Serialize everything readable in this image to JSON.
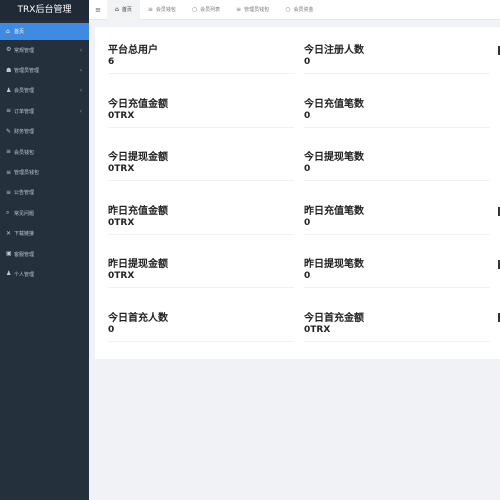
{
  "app": {
    "title": "TRX后台管理"
  },
  "sidebar": {
    "items": [
      {
        "label": "首页",
        "icon": "home-icon",
        "glyph": "⌂",
        "active": true,
        "has_arrow": false
      },
      {
        "label": "常规管理",
        "icon": "gears-icon",
        "glyph": "⚙",
        "active": false,
        "has_arrow": true
      },
      {
        "label": "管理员管理",
        "icon": "users-icon",
        "glyph": "☗",
        "active": false,
        "has_arrow": true
      },
      {
        "label": "会员管理",
        "icon": "user-icon",
        "glyph": "♟",
        "active": false,
        "has_arrow": true
      },
      {
        "label": "订单管理",
        "icon": "list-icon",
        "glyph": "≡",
        "active": false,
        "has_arrow": true
      },
      {
        "label": "财务管理",
        "icon": "edit-icon",
        "glyph": "✎",
        "active": false,
        "has_arrow": false
      },
      {
        "label": "会员钱包",
        "icon": "list-icon",
        "glyph": "≡",
        "active": false,
        "has_arrow": false
      },
      {
        "label": "管理员钱包",
        "icon": "list-icon",
        "glyph": "≡",
        "active": false,
        "has_arrow": false
      },
      {
        "label": "公告管理",
        "icon": "list-icon",
        "glyph": "≡",
        "active": false,
        "has_arrow": false
      },
      {
        "label": "常见问题",
        "icon": "search-icon",
        "glyph": "⌕",
        "active": false,
        "has_arrow": false
      },
      {
        "label": "下载链接",
        "icon": "close-icon",
        "glyph": "✕",
        "active": false,
        "has_arrow": false
      },
      {
        "label": "客服管理",
        "icon": "image-icon",
        "glyph": "▣",
        "active": false,
        "has_arrow": false
      },
      {
        "label": "个人管理",
        "icon": "user-icon",
        "glyph": "♟",
        "active": false,
        "has_arrow": false
      }
    ]
  },
  "topbar": {
    "menu_icon": "hamburger-icon",
    "tabs": [
      {
        "label": "首页",
        "icon": "home-icon",
        "glyph": "⌂",
        "active": true
      },
      {
        "label": "会员钱包",
        "icon": "list-icon",
        "glyph": "≡",
        "active": false
      },
      {
        "label": "会员列表",
        "icon": "circle-icon",
        "glyph": "○",
        "active": false
      },
      {
        "label": "管理员钱包",
        "icon": "list-icon",
        "glyph": "≡",
        "active": false
      },
      {
        "label": "会员资金",
        "icon": "circle-icon",
        "glyph": "○",
        "active": false
      }
    ]
  },
  "stats": [
    {
      "label": "平台总用户",
      "value": "6"
    },
    {
      "label": "今日注册人数",
      "value": "0"
    },
    {
      "label": "今日充值金额",
      "value": "0TRX"
    },
    {
      "label": "今日充值笔数",
      "value": "0"
    },
    {
      "label": "今日提现金额",
      "value": "0TRX"
    },
    {
      "label": "今日提现笔数",
      "value": "0"
    },
    {
      "label": "昨日充值金额",
      "value": "0TRX"
    },
    {
      "label": "昨日充值笔数",
      "value": "0"
    },
    {
      "label": "昨日提现金额",
      "value": "0TRX"
    },
    {
      "label": "昨日提现笔数",
      "value": "0"
    },
    {
      "label": "今日首充人数",
      "value": "0"
    },
    {
      "label": "今日首充金额",
      "value": "0TRX"
    }
  ],
  "colors": {
    "sidebar_bg": "#24303c",
    "active_accent": "#3f8ae3",
    "page_bg": "#f0f2f5"
  }
}
